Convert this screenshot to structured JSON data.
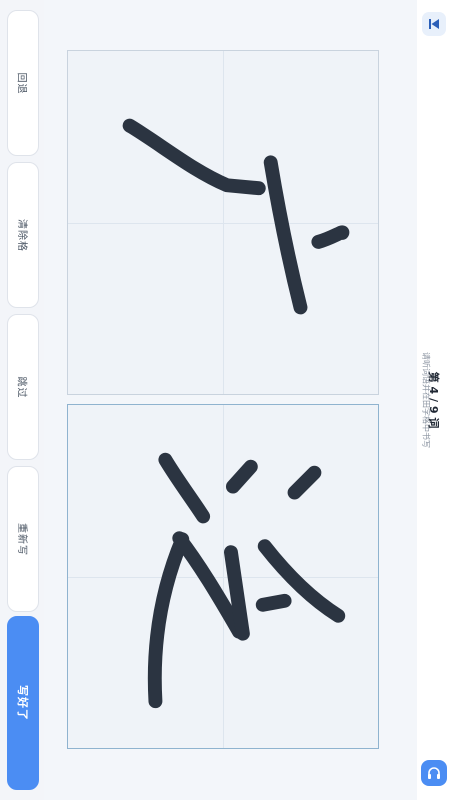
{
  "toolbar": {
    "buttons": [
      {
        "label": "回退"
      },
      {
        "label": "清除格"
      },
      {
        "label": "跳过"
      },
      {
        "label": "重新写"
      },
      {
        "label": "写好了"
      }
    ]
  },
  "progress": {
    "prefix": "第",
    "current": "4",
    "separator": "/",
    "total": "9",
    "suffix": "词"
  },
  "hint": "请听词语并在田字格中书写",
  "icons": {
    "top": "skip-back-icon",
    "bottom": "headphones-icon"
  },
  "colors": {
    "accent": "#4b8df3",
    "ink": "#2b3441"
  }
}
